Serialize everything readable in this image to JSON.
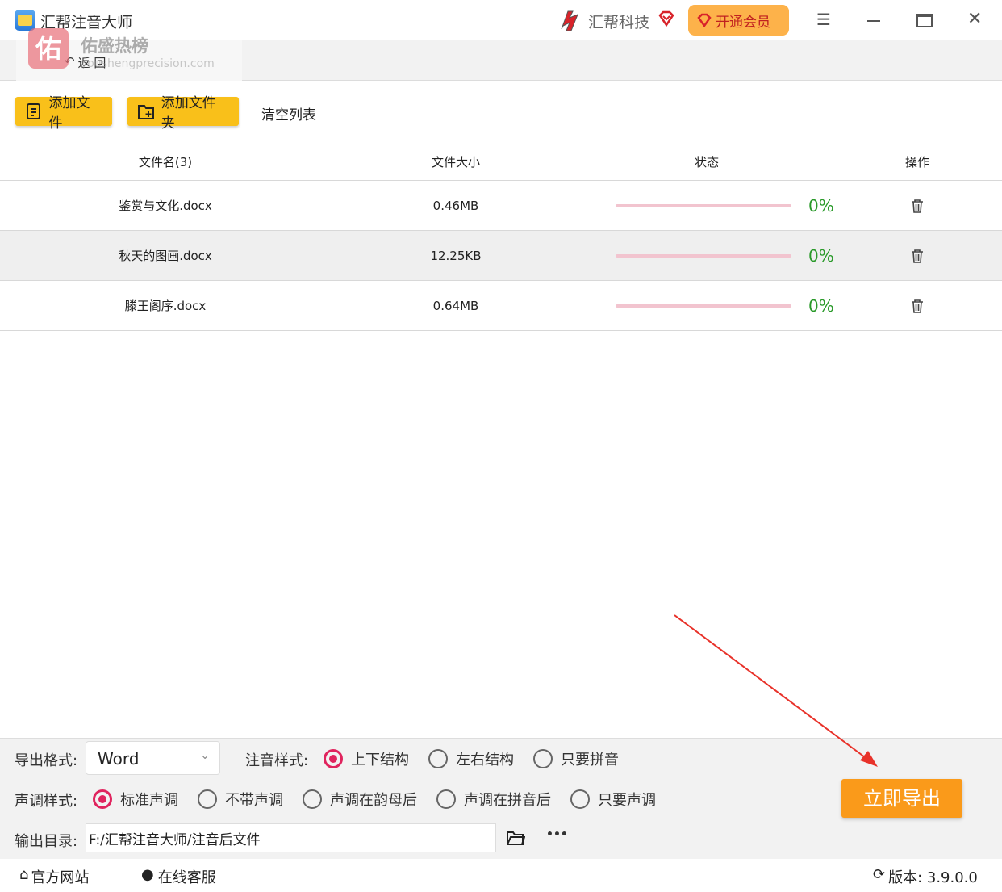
{
  "app": {
    "title": "汇帮注音大师",
    "brand": "汇帮科技",
    "vip_label": "开通会员",
    "back_label": "返 回"
  },
  "watermark": {
    "char": "佑",
    "text": "佑盛热榜",
    "url": "youshengprecision.com"
  },
  "toolbar": {
    "add_file": "添加文件",
    "add_folder": "添加文件夹",
    "clear_list": "清空列表"
  },
  "table": {
    "headers": [
      "文件名(3)",
      "文件大小",
      "状态",
      "操作"
    ],
    "rows": [
      {
        "name": "鉴赏与文化.docx",
        "size": "0.46MB",
        "progress": "0%"
      },
      {
        "name": "秋天的图画.docx",
        "size": "12.25KB",
        "progress": "0%"
      },
      {
        "name": "滕王阁序.docx",
        "size": "0.64MB",
        "progress": "0%"
      }
    ]
  },
  "settings": {
    "format_label": "导出格式:",
    "format_value": "Word",
    "pinyin_style_label": "注音样式:",
    "pinyin_styles": [
      "上下结构",
      "左右结构",
      "只要拼音"
    ],
    "pinyin_selected": 0,
    "tone_label": "声调样式:",
    "tones": [
      "标准声调",
      "不带声调",
      "声调在韵母后",
      "声调在拼音后",
      "只要声调"
    ],
    "tone_selected": 0,
    "output_label": "输出目录:",
    "output_path": "F:/汇帮注音大师/注音后文件",
    "more": "•••",
    "export_button": "立即导出"
  },
  "footer": {
    "website": "官方网站",
    "support": "在线客服",
    "version": "版本: 3.9.0.0"
  },
  "colors": {
    "accent": "#f9c01a",
    "export": "#fa9a1a",
    "radio": "#e0245e",
    "progress_text": "#2a9a2a",
    "vip": "#fdb24a"
  }
}
